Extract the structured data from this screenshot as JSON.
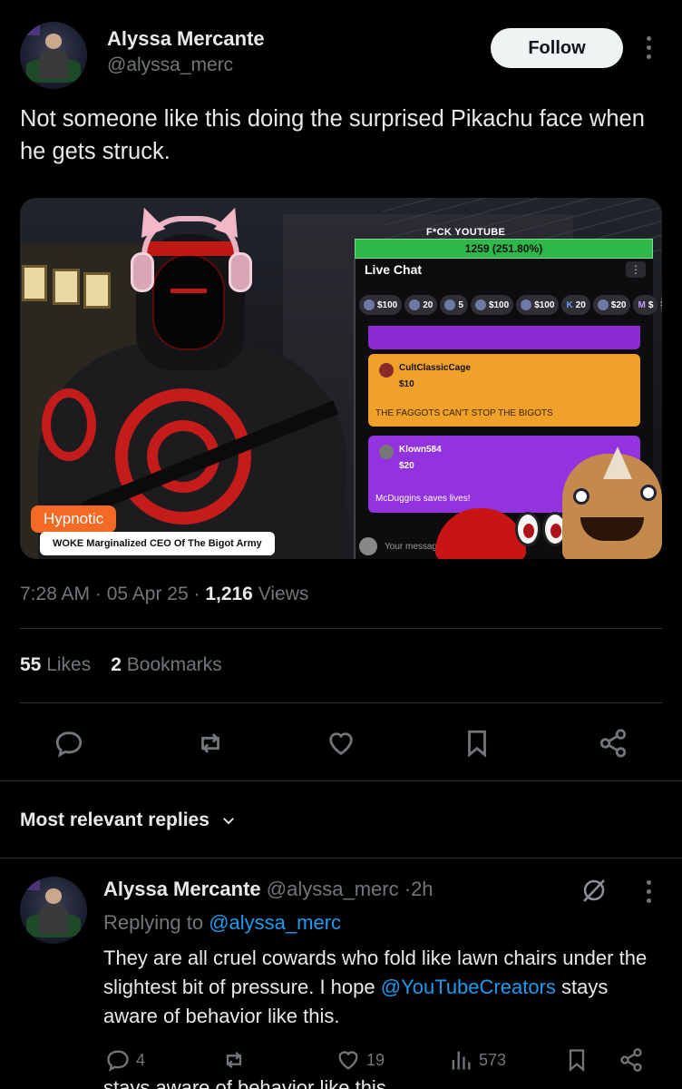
{
  "tweet": {
    "author_name": "Alyssa Mercante",
    "author_handle": "@alyssa_merc",
    "follow_label": "Follow",
    "text": "Not someone like this doing the surprised Pikachu face when he gets struck.",
    "time": "7:28 AM",
    "date": "05 Apr 25",
    "views_count": "1,216",
    "views_label": "Views",
    "likes_count": "55",
    "likes_label": "Likes",
    "bookmarks_count": "2",
    "bookmarks_label": "Bookmarks"
  },
  "media": {
    "badge_hypnotic": "Hypnotic",
    "badge_caption": "WOKE Marginalized CEO Of The Bigot Army",
    "overlay_title": "F*CK YOUTUBE",
    "progress_text": "1259 (251.80%)",
    "progress_fraction": 1.0,
    "chat_title": "Live Chat",
    "tips": [
      {
        "label": "$100",
        "type": "coin"
      },
      {
        "label": "20",
        "type": "coin"
      },
      {
        "label": "5",
        "type": "coin"
      },
      {
        "label": "$100",
        "type": "coin"
      },
      {
        "label": "$100",
        "type": "coin"
      },
      {
        "label": "20",
        "type": "k"
      },
      {
        "label": "$20",
        "type": "coin"
      },
      {
        "label": "$",
        "type": "m"
      }
    ],
    "tip_badge_k": "K",
    "tip_badge_m": "M",
    "tips_more": "»",
    "messages": [
      {
        "user": "CultClassicCage",
        "amount": "$10",
        "text": "THE FAGGOTS CAN'T STOP THE BIGOTS",
        "color": "#f0a12a"
      },
      {
        "user": "Klown584",
        "amount": "$20",
        "text": "McDuggins saves lives!",
        "color": "#9333e0"
      }
    ],
    "chat_placeholder": "Your message"
  },
  "icons": {
    "reply": "reply-icon",
    "repost": "repost-icon",
    "like": "heart-icon",
    "bookmark": "bookmark-icon",
    "share": "share-icon",
    "grok": "grok-icon",
    "views": "bar-chart-icon",
    "chevron": "chevron-down-icon"
  },
  "replies_section": {
    "heading": "Most relevant replies"
  },
  "reply": {
    "author_name": "Alyssa Mercante",
    "author_handle": "@alyssa_merc",
    "separator": "·",
    "time": "2h",
    "replying_to_label": "Replying to",
    "replying_to_handle": "@alyssa_merc",
    "text_part1": "They are all cruel cowards who fold like lawn chairs under the slightest bit of pressure. I hope ",
    "text_mention": "@YouTubeCreators",
    "text_part2": " stays aware of behavior like this.",
    "reply_count": "4",
    "like_count": "19",
    "views_count": "573",
    "cutoff_text": "stays aware of behavior like this."
  },
  "colors": {
    "background": "#000000",
    "text_primary": "#e7e9ea",
    "text_secondary": "#71767b",
    "link": "#1d9bf0",
    "follow_bg": "#eff3f4"
  }
}
